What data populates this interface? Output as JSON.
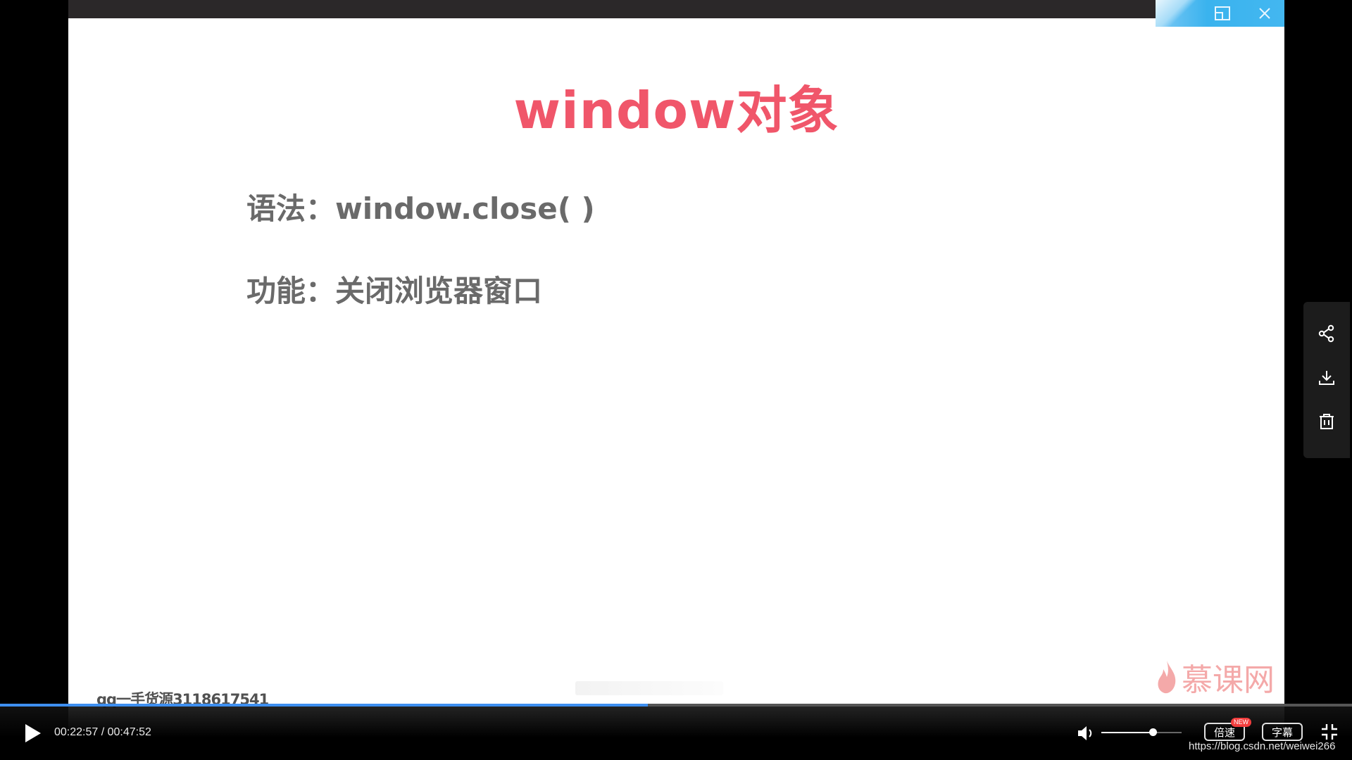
{
  "slide": {
    "title": "window对象",
    "line1": "语法：window.close( )",
    "line2": "功能：关闭浏览器窗口"
  },
  "watermarks": {
    "logo_text": "慕课网",
    "qq_text": "qq一手货源3118617541"
  },
  "player": {
    "current_time": "00:22:57",
    "separator": " / ",
    "total_time": "00:47:52",
    "progress_fraction": 0.479,
    "volume_fraction": 0.64,
    "speed_label": "倍速",
    "new_badge": "NEW",
    "subtitle_label": "字幕",
    "accent_color": "#3e8ff0"
  },
  "side_panel": {
    "icons": [
      "share-icon",
      "download-icon",
      "delete-icon"
    ]
  },
  "window_controls": {
    "icons": [
      "restore-icon",
      "close-icon"
    ]
  },
  "caption": {
    "url": "https://blog.csdn.net/weiwei266"
  }
}
